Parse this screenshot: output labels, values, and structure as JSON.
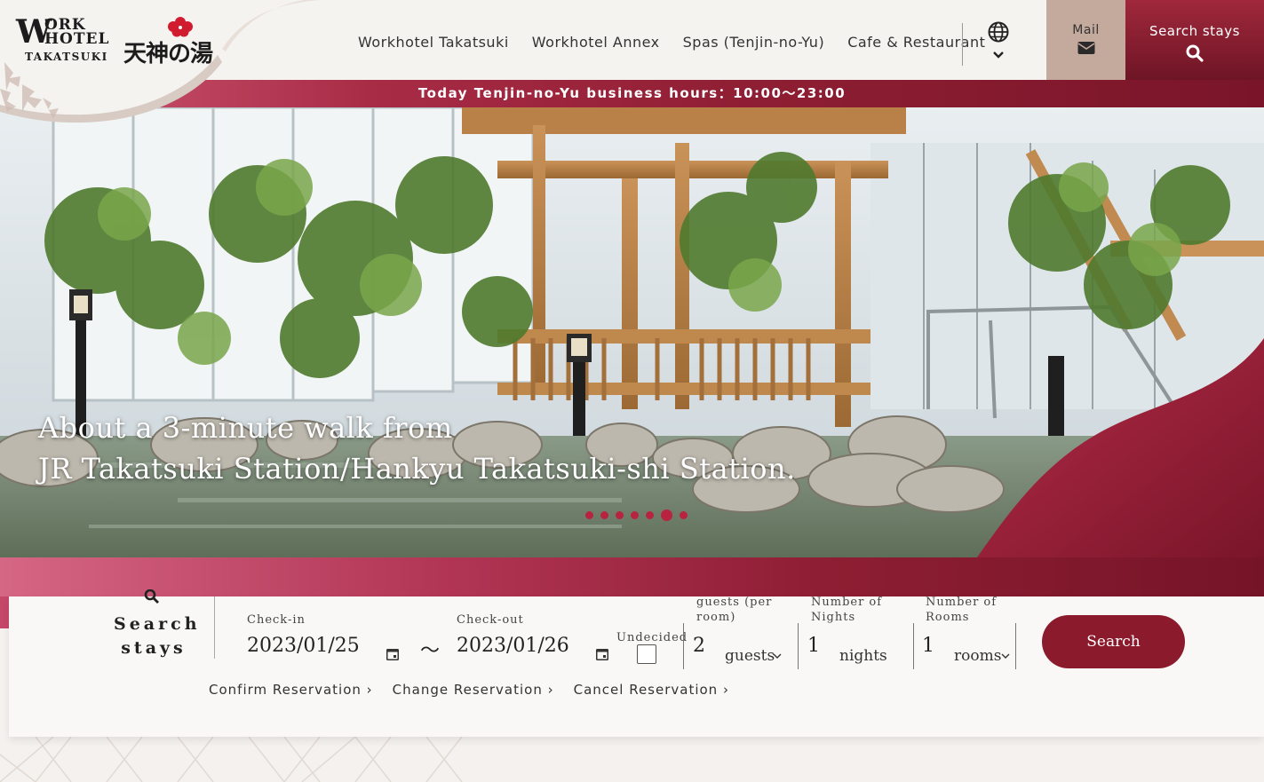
{
  "header": {
    "logo": {
      "w": "W",
      "ork": "ORK",
      "hotel": "HOTEL",
      "takatsuki": "TAKATSUKI",
      "jp": "天神の湯"
    },
    "nav": [
      {
        "label": "Workhotel Takatsuki"
      },
      {
        "label": "Workhotel Annex"
      },
      {
        "label": "Spas (Tenjin-no-Yu)"
      },
      {
        "label": "Cafe & Restaurant"
      }
    ],
    "mail_label": "Mail",
    "search_label": "Search stays"
  },
  "hours_bar": "Today Tenjin-no-Yu business hours：10:00～23:00",
  "hero": {
    "caption_line1": "About a 3-minute walk from",
    "caption_line2": "JR Takatsuki Station/Hankyu Takatsuki-shi Station.",
    "slide_count": 7,
    "active_slide": 6
  },
  "search_panel": {
    "title": "Search stays",
    "checkin_label": "Check-in",
    "checkin_value": "2023/01/25",
    "separator": "～",
    "checkout_label": "Check-out",
    "checkout_value": "2023/01/26",
    "undecided_label": "Undecided",
    "guests_label": "guests (per room)",
    "guests_value": "2",
    "guests_unit": "guests",
    "nights_label": "Number of Nights",
    "nights_value": "1",
    "nights_unit": "nights",
    "rooms_label": "Number of Rooms",
    "rooms_value": "1",
    "rooms_unit": "rooms",
    "search_button": "Search",
    "links": [
      {
        "label": "Confirm Reservation ›"
      },
      {
        "label": "Change Reservation ›"
      },
      {
        "label": "Cancel Reservation ›"
      }
    ]
  },
  "colors": {
    "brand": "#8a1a2c",
    "accent": "#b8243f",
    "mail_bg": "#c4a99d"
  }
}
